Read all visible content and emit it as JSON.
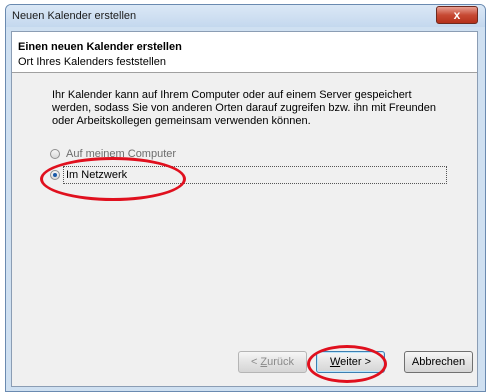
{
  "window": {
    "title": "Neuen Kalender erstellen",
    "close_label": "x"
  },
  "header": {
    "title": "Einen neuen Kalender erstellen",
    "subtitle": "Ort Ihres Kalenders feststellen"
  },
  "body": {
    "description": "Ihr Kalender kann auf Ihrem Computer oder auf einem Server gespeichert werden, sodass Sie von anderen Orten darauf zugreifen bzw. ihn mit Freunden oder Arbeitskollegen gemeinsam verwenden können.",
    "options": [
      {
        "label": "Auf meinem Computer",
        "selected": false
      },
      {
        "label": "Im Netzwerk",
        "selected": true
      }
    ]
  },
  "buttons": {
    "back_underline": "Z",
    "back_rest": "urück",
    "back_prefix": "< ",
    "next_underline": "W",
    "next_rest": "eiter >",
    "cancel": "Abbrechen"
  },
  "annotations": {
    "color": "#e0101e"
  }
}
